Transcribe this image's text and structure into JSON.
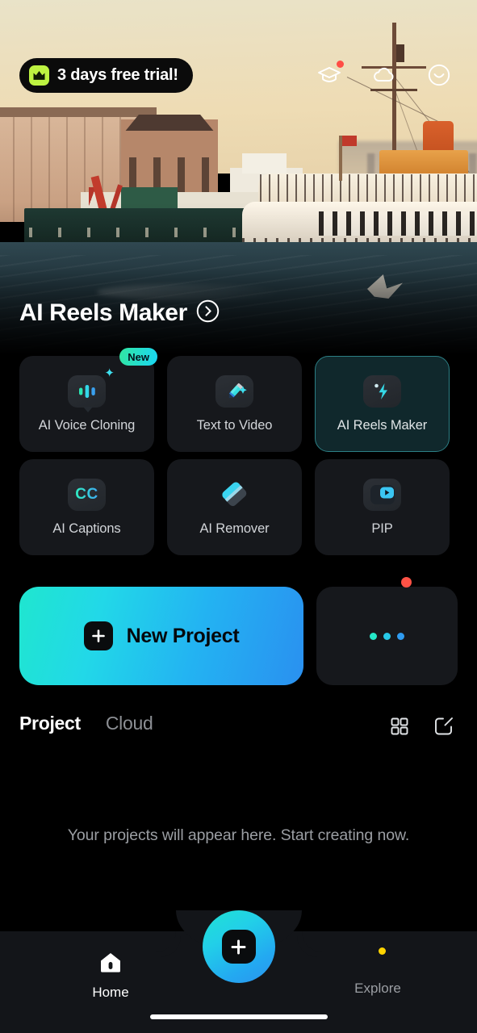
{
  "header": {
    "trial_badge": {
      "label": "3 days free trial!",
      "icon": "crown-icon",
      "badge_color": "#bdf241"
    },
    "icons": [
      {
        "name": "graduation-cap-icon",
        "has_notification": true,
        "notification_color": "#ff4d45"
      },
      {
        "name": "cloud-icon",
        "has_notification": false
      },
      {
        "name": "smiley-face-icon",
        "has_notification": false
      }
    ]
  },
  "hero": {
    "title": "AI Reels Maker",
    "arrow_icon": "chevron-right-circle-icon"
  },
  "tools": [
    {
      "label": "AI Voice Cloning",
      "icon": "voice-waveform-bubble-icon",
      "badge": "New",
      "selected": false
    },
    {
      "label": "Text  to Video",
      "icon": "pencil-sparkle-icon",
      "badge": null,
      "selected": false
    },
    {
      "label": "AI Reels Maker",
      "icon": "lightning-bolt-icon",
      "badge": null,
      "selected": true
    },
    {
      "label": "AI Captions",
      "icon": "closed-caption-icon",
      "badge": null,
      "selected": false
    },
    {
      "label": "AI Remover",
      "icon": "eraser-icon",
      "badge": null,
      "selected": false
    },
    {
      "label": "PIP",
      "icon": "picture-in-picture-icon",
      "badge": null,
      "selected": false
    }
  ],
  "new_project": {
    "label": "New Project",
    "plus_icon": "plus-icon",
    "gradient_from": "#1fe6cf",
    "gradient_to": "#2a90f0"
  },
  "more_tile": {
    "icon": "three-dots-icon",
    "has_notification": true,
    "notification_color": "#ff5246",
    "dot_colors": [
      "#24e8c8",
      "#27c9e8",
      "#2f9bf0"
    ]
  },
  "project_section": {
    "tabs": [
      {
        "label": "Project",
        "active": true
      },
      {
        "label": "Cloud",
        "active": false
      }
    ],
    "actions": [
      {
        "name": "grid-view-icon"
      },
      {
        "name": "edit-icon"
      }
    ],
    "empty_message": "Your projects will appear here. Start creating now."
  },
  "bottom_nav": {
    "items": [
      {
        "label": "Home",
        "icon": "home-icon",
        "active": true,
        "has_notification": false
      },
      {
        "label": "Explore",
        "icon": "explore-icon",
        "active": false,
        "has_notification": true,
        "notification_color": "#ffd400"
      }
    ],
    "fab": {
      "icon": "plus-icon",
      "gradient_from": "#1fe3d4",
      "gradient_to": "#2b93ef"
    }
  }
}
